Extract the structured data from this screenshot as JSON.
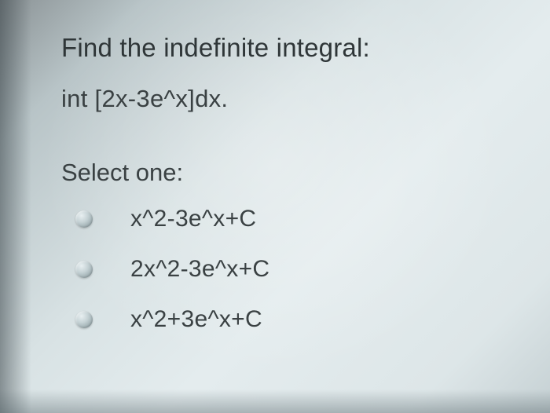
{
  "question": {
    "title": "Find the indefinite integral:",
    "expression": "int [2x-3e^x]dx."
  },
  "select_label": "Select one:",
  "options": [
    {
      "text": "x^2-3e^x+C"
    },
    {
      "text": "2x^2-3e^x+C"
    },
    {
      "text": "x^2+3e^x+C"
    }
  ]
}
